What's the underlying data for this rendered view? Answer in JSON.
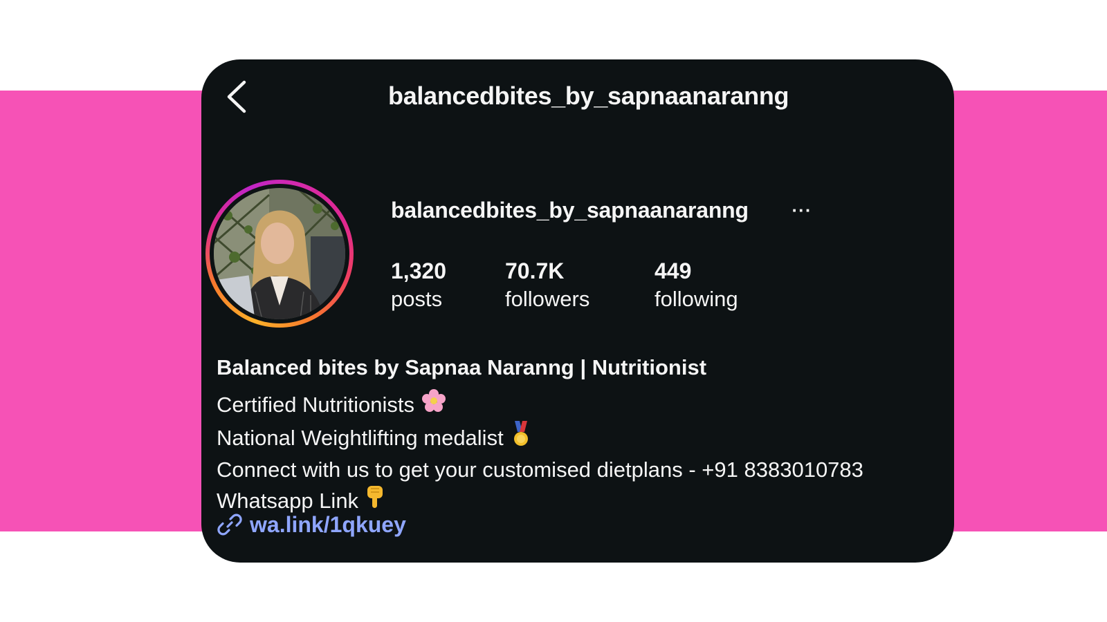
{
  "header": {
    "title": "balancedbites_by_sapnaanaranng"
  },
  "profile": {
    "username": "balancedbites_by_sapnaanaranng",
    "more_label": "···",
    "stats": [
      {
        "value": "1,320",
        "label": "posts"
      },
      {
        "value": "70.7K",
        "label": "followers"
      },
      {
        "value": "449",
        "label": "following"
      }
    ]
  },
  "bio": {
    "name": "Balanced bites by Sapnaa Naranng | Nutritionist",
    "lines": [
      {
        "text": "Certified Nutritionists",
        "emoji": "flower-icon"
      },
      {
        "text": "National Weightlifting medalist",
        "emoji": "medal-icon"
      },
      {
        "text": "Connect with us to get your customised dietplans - +91 8383010783",
        "emoji": ""
      },
      {
        "text": "Whatsapp Link",
        "emoji": "pointing-down-icon"
      }
    ],
    "link": "wa.link/1qkuey"
  },
  "colors": {
    "background_band": "#f652b6",
    "card": "#0d1214",
    "link": "#8fa6ff"
  }
}
